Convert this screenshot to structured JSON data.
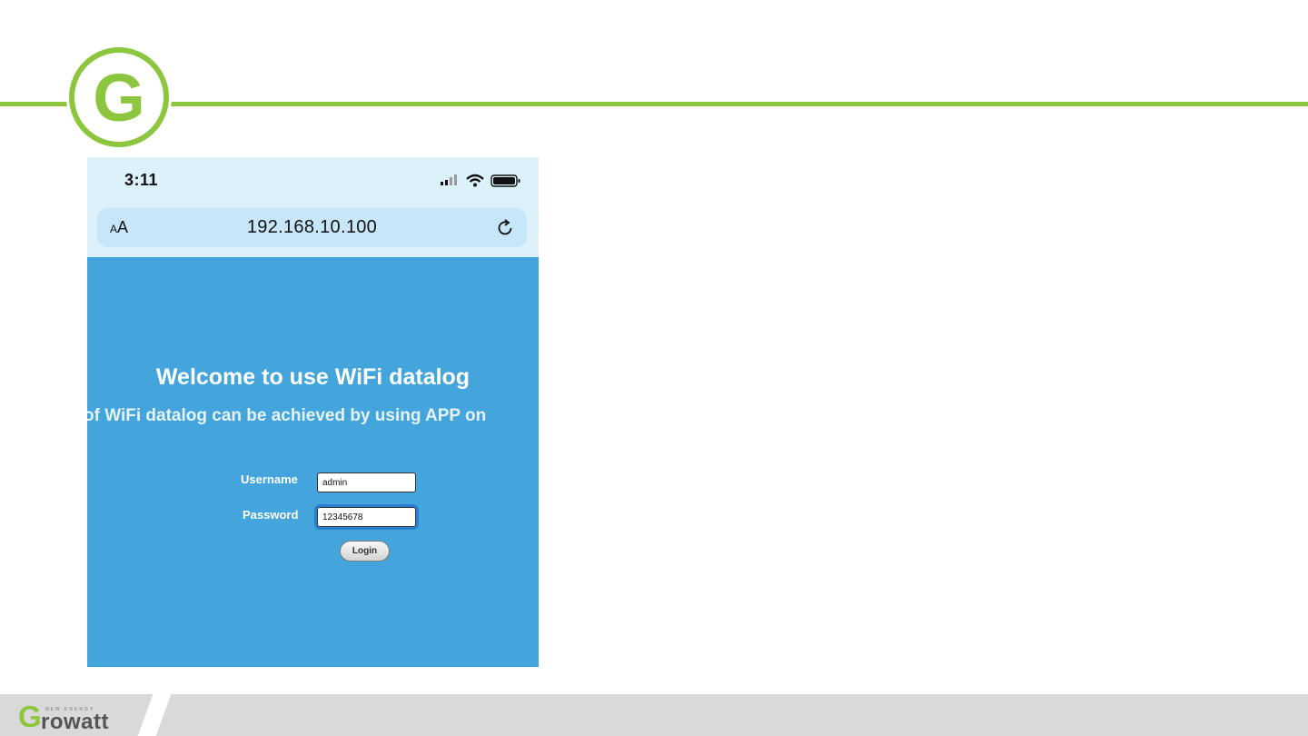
{
  "logo": {
    "letter": "G",
    "color": "#8cc63f"
  },
  "phone": {
    "status": {
      "time": "3:11",
      "icons": [
        "cellular-signal-icon",
        "wifi-icon",
        "battery-icon"
      ]
    },
    "browser": {
      "text_size_label": "AA",
      "url": "192.168.10.100",
      "reload_icon": "reload-icon"
    },
    "page": {
      "title": "Welcome to use WiFi datalog",
      "subtitle": "of WiFi datalog can be achieved by using APP on",
      "username_label": "Username",
      "username_value": "admin",
      "password_label": "Password",
      "password_value": "12345678",
      "login_label": "Login",
      "background": "#43a5dc"
    }
  },
  "footer": {
    "brand_initial": "G",
    "brand_rest": "rowatt",
    "brand_tagline": "NEW ENERGY"
  }
}
